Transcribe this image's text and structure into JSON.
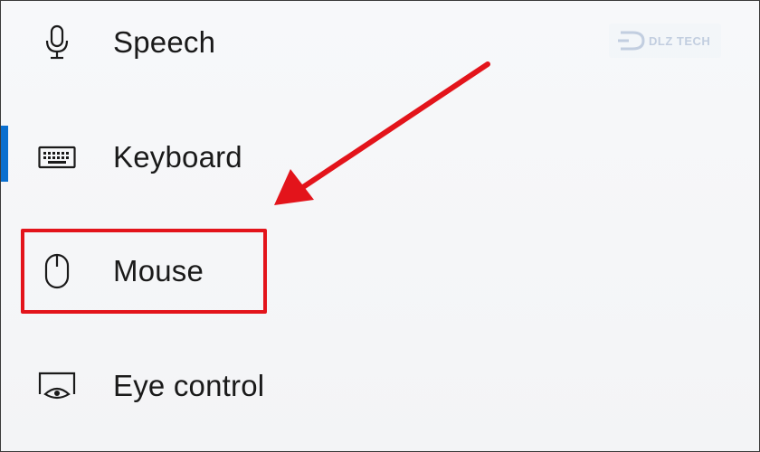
{
  "settings_nav": {
    "items": [
      {
        "label": "Speech",
        "icon": "microphone-icon"
      },
      {
        "label": "Keyboard",
        "icon": "keyboard-icon",
        "selected": true
      },
      {
        "label": "Mouse",
        "icon": "mouse-icon",
        "highlighted": true
      },
      {
        "label": "Eye control",
        "icon": "eye-control-icon"
      }
    ]
  },
  "annotation": {
    "arrow_color": "#e3141b",
    "box_color": "#e3141b",
    "target": "Mouse"
  },
  "watermark": {
    "text": "DLZ TECH"
  },
  "colors": {
    "accent": "#0a6fcf",
    "background": "#f5f6f8",
    "text": "#1a1a1a"
  }
}
